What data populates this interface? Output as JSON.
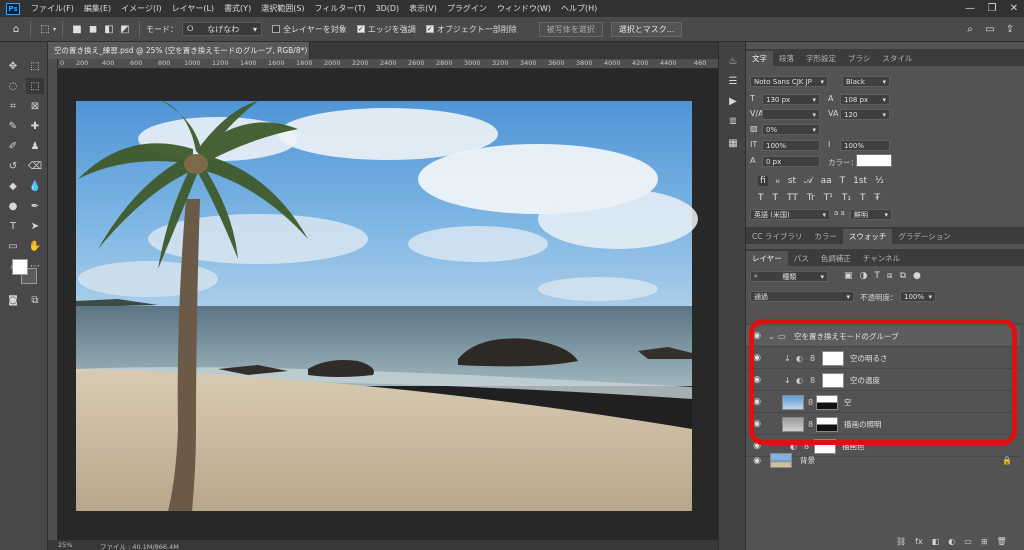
{
  "menubar": {
    "logo": "Ps",
    "items": [
      "ファイル(F)",
      "編集(E)",
      "イメージ(I)",
      "レイヤー(L)",
      "書式(Y)",
      "選択範囲(S)",
      "フィルター(T)",
      "3D(D)",
      "表示(V)",
      "プラグイン",
      "ウィンドウ(W)",
      "ヘルプ(H)"
    ],
    "controls": [
      "—",
      "❐",
      "✕"
    ]
  },
  "options": {
    "mode_label": "モード：",
    "mode_value": "なげなわ",
    "all_layers": "全レイヤーを対象",
    "enhance_edge": "エッジを強調",
    "object_subtract": "オブジェクト一部削除",
    "select_subject": "被写体を選択",
    "select_mask": "選択とマスク..."
  },
  "document": {
    "tab_title": "空の置き換え_練習.psd @ 25% (空を置き換えモードのグループ, RGB/8*) *",
    "ruler_labels": [
      "0",
      "200",
      "400",
      "600",
      "800",
      "1000",
      "1200",
      "1400",
      "1600",
      "1800",
      "2000",
      "2200",
      "2400",
      "2600",
      "2800",
      "3000",
      "3200",
      "3400",
      "3600",
      "3800",
      "4000",
      "4200",
      "4400",
      "460"
    ],
    "zoom": "25%",
    "file_info": "ファイル : 40.1M/866.4M"
  },
  "character_panel": {
    "tabs": [
      "文字",
      "段落",
      "字形設定",
      "ブラシ",
      "スタイル"
    ],
    "font_family": "Noto Sans CJK JP",
    "font_style": "Black",
    "font_size": "130 px",
    "leading": "108 px",
    "kerning": "",
    "tracking": "120",
    "tsume": "0%",
    "vertical_scale": "100%",
    "horizontal_scale": "100%",
    "baseline_shift": "0 px",
    "color_label": "カラー：",
    "language": "英語 (米国)",
    "aa_label": "a a",
    "aa_value": "鮮明"
  },
  "library_tabs": [
    "CC ライブラリ",
    "カラー",
    "スウォッチ",
    "グラデーション"
  ],
  "layers_panel": {
    "tabs": [
      "レイヤー",
      "パス",
      "色調補正",
      "チャンネル"
    ],
    "filter_kind": "種類",
    "blend_mode": "通過",
    "opacity_label": "不透明度：",
    "opacity_value": "100%",
    "layers": [
      {
        "name": "空を置き換えモードのグループ"
      },
      {
        "name": "空の明るさ"
      },
      {
        "name": "空の温度"
      },
      {
        "name": "空"
      },
      {
        "name": "描画の照明"
      },
      {
        "name": "描画色"
      },
      {
        "name": "背景"
      }
    ],
    "bottom_icons": [
      "⛓",
      "fx",
      "◧",
      "◐",
      "▭",
      "⊞",
      "🗑"
    ]
  },
  "colors": {
    "highlight_box": "#e01010",
    "sky": "#6aaae0",
    "sea": "#7e9aa8",
    "sand": "#c8b9a0"
  }
}
